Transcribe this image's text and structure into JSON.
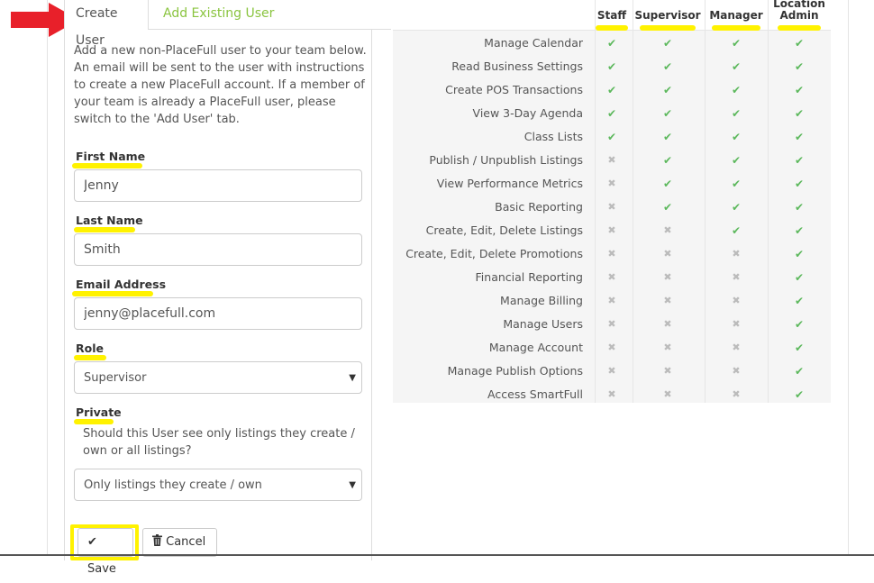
{
  "tabs": {
    "create": "Create User",
    "existing": "Add Existing User"
  },
  "intro": "Add a new non-PlaceFull user to your team below. An email will be sent to the user with instructions to create a new PlaceFull account. If a member of your team is already a PlaceFull user, please switch to the 'Add User' tab.",
  "form": {
    "first_name_label": "First Name",
    "first_name_value": "Jenny",
    "last_name_label": "Last Name",
    "last_name_value": "Smith",
    "email_label": "Email Address",
    "email_value": "jenny@placefull.com",
    "role_label": "Role",
    "role_value": "Supervisor",
    "private_label": "Private",
    "private_help": "Should this User see only listings they create / own or all listings?",
    "private_value": "Only listings they create / own"
  },
  "buttons": {
    "save": "Save",
    "cancel": "Cancel"
  },
  "permissions": {
    "columns": [
      "Staff",
      "Supervisor",
      "Manager",
      "Location Admin"
    ],
    "rows": [
      {
        "label": "Manage Calendar",
        "values": [
          1,
          1,
          1,
          1
        ]
      },
      {
        "label": "Read Business Settings",
        "values": [
          1,
          1,
          1,
          1
        ]
      },
      {
        "label": "Create POS Transactions",
        "values": [
          1,
          1,
          1,
          1
        ]
      },
      {
        "label": "View 3-Day Agenda",
        "values": [
          1,
          1,
          1,
          1
        ]
      },
      {
        "label": "Class Lists",
        "values": [
          1,
          1,
          1,
          1
        ]
      },
      {
        "label": "Publish / Unpublish Listings",
        "values": [
          0,
          1,
          1,
          1
        ]
      },
      {
        "label": "View Performance Metrics",
        "values": [
          0,
          1,
          1,
          1
        ]
      },
      {
        "label": "Basic Reporting",
        "values": [
          0,
          1,
          1,
          1
        ]
      },
      {
        "label": "Create, Edit, Delete Listings",
        "values": [
          0,
          0,
          1,
          1
        ]
      },
      {
        "label": "Create, Edit, Delete Promotions",
        "values": [
          0,
          0,
          0,
          1
        ]
      },
      {
        "label": "Financial Reporting",
        "values": [
          0,
          0,
          0,
          1
        ]
      },
      {
        "label": "Manage Billing",
        "values": [
          0,
          0,
          0,
          1
        ]
      },
      {
        "label": "Manage Users",
        "values": [
          0,
          0,
          0,
          1
        ]
      },
      {
        "label": "Manage Account",
        "values": [
          0,
          0,
          0,
          1
        ]
      },
      {
        "label": "Manage Publish Options",
        "values": [
          0,
          0,
          0,
          1
        ]
      },
      {
        "label": "Access SmartFull",
        "values": [
          0,
          0,
          0,
          1
        ]
      }
    ]
  },
  "colors": {
    "accent_green": "#8ac43f",
    "check": "#5cb85c",
    "highlight": "#fff200",
    "arrow": "#e8202a"
  },
  "icons": {
    "save": "check-icon",
    "cancel": "trash-icon",
    "arrow": "red-arrow-icon"
  }
}
